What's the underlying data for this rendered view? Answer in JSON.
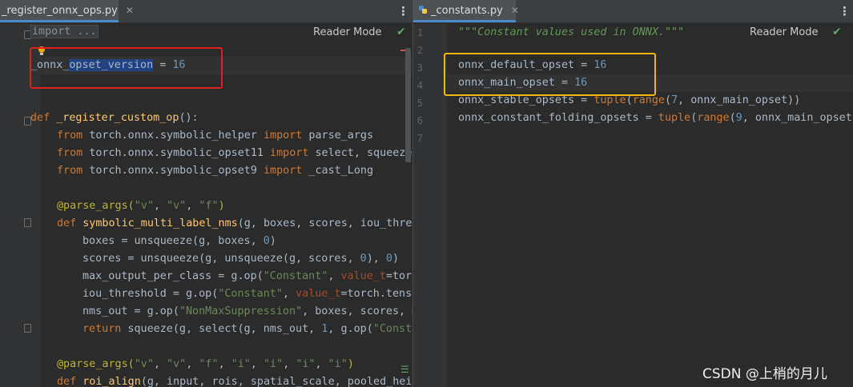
{
  "left_tab": {
    "label": "_register_onnx_ops.py",
    "close": "✕"
  },
  "right_tab": {
    "label": "_constants.py",
    "close": "✕"
  },
  "toolbar": {
    "reader_mode": "Reader Mode",
    "kebab": "⋮",
    "check": "✔"
  },
  "left_code": {
    "folded_import": "import ...",
    "opset_var": "_onnx_",
    "opset_var_sel": "opset_version",
    "opset_eq": " = ",
    "opset_val": "16",
    "def_kw": "def",
    "def_name": "_register_custom_op",
    "def_tail": "():",
    "from": "from",
    "import": "import",
    "mod1": "torch.onnx.symbolic_helper",
    "imp1": "parse_args",
    "mod2": "torch.onnx.symbolic_opset11",
    "imp2": "select, squeeze",
    "mod3": "torch.onnx.symbolic_opset9",
    "imp3": "_cast_Long",
    "dec1": "@parse_args(",
    "dec1_args": [
      "\"v\"",
      "\"v\"",
      "\"f\""
    ],
    "def2_name": "symbolic_multi_label_nms",
    "def2_args": "(g, boxes, scores, iou_thres",
    "l_boxes": "boxes = unsqueeze(g, boxes, ",
    "l_boxes_num": "0",
    "l_boxes_tail": ")",
    "l_scores": "scores = unsqueeze(g, unsqueeze(g, scores, ",
    "l_scores_n1": "0",
    "l_scores_mid": "), ",
    "l_scores_n2": "0",
    "l_scores_tail": ")",
    "l_max": "max_output_per_class = g.op(",
    "l_max_str": "\"Constant\"",
    "l_max_mid": ", ",
    "l_max_param": "value_t",
    "l_max_tail": "=torc",
    "l_iou": "iou_threshold = g.op(",
    "l_iou_str": "\"Constant\"",
    "l_iou_mid": ", ",
    "l_iou_param": "value_t",
    "l_iou_tail": "=torch.tenso",
    "l_nms": "nms_out = g.op(",
    "l_nms_str": "\"NonMaxSuppression\"",
    "l_nms_tail": ", boxes, scores, m",
    "l_ret_kw": "return",
    "l_ret": " squeeze(g, select(g, nms_out, ",
    "l_ret_num": "1",
    "l_ret_mid": ", g.op(",
    "l_ret_str": "\"Consta",
    "dec2": "@parse_args(",
    "dec2_args": [
      "\"v\"",
      "\"v\"",
      "\"f\"",
      "\"i\"",
      "\"i\"",
      "\"i\"",
      "\"i\""
    ],
    "def3_name": "roi_align",
    "def3_args": "(g, input, rois, spatial_scale, pooled_heig"
  },
  "right_code": {
    "line_numbers": [
      "1",
      "2",
      "3",
      "4",
      "5",
      "6",
      "7"
    ],
    "docstring": "\"\"\"Constant values used in ONNX.\"\"\"",
    "l3_name": "onnx_default_opset = ",
    "l3_val": "16",
    "l4_name": "onnx_main_opset = ",
    "l4_val": "16",
    "l5_name": "onnx_stable_opsets = ",
    "l5_fn1": "tuple",
    "l5_p": "(",
    "l5_fn2": "range",
    "l5_p2": "(",
    "l5_num": "7",
    "l5_tail": ", onnx_main_opset))",
    "l6_name": "onnx_constant_folding_opsets = ",
    "l6_fn1": "tuple",
    "l6_p": "(",
    "l6_fn2": "range",
    "l6_p2": "(",
    "l6_num": "9",
    "l6_tail": ", onnx_main_opset"
  },
  "watermark": "CSDN @上梢的月儿",
  "colors": {
    "editor_bg": "#2b2b2b",
    "keyword": "#cc7832",
    "function": "#ffc66d",
    "string": "#6a8759",
    "number": "#6897bb",
    "highlight_red": "#e02020",
    "highlight_orange": "#f5b800"
  }
}
